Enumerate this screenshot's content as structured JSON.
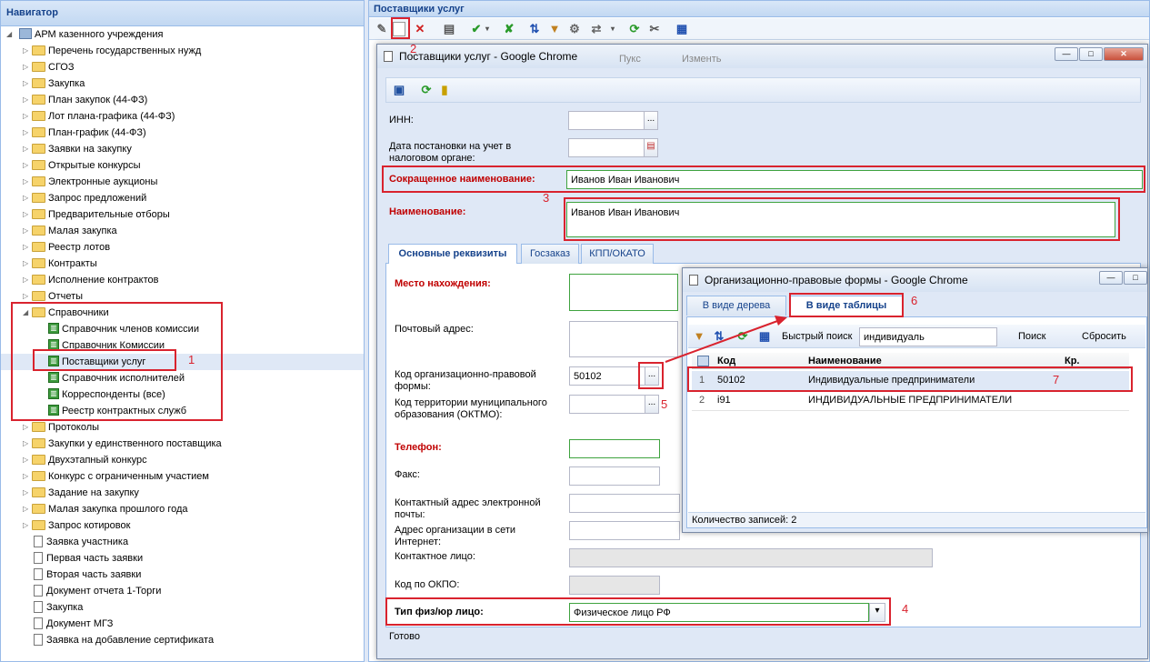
{
  "navigator": {
    "title": "Навигатор",
    "root": "АРМ казенного учреждения",
    "items": [
      "Перечень государственных нужд",
      "СГОЗ",
      "Закупка",
      "План закупок (44-ФЗ)",
      "Лот плана-графика (44-ФЗ)",
      "План-график (44-ФЗ)",
      "Заявки на закупку",
      "Открытые конкурсы",
      "Электронные аукционы",
      "Запрос предложений",
      "Предварительные отборы",
      "Малая закупка",
      "Реестр лотов",
      "Контракты",
      "Исполнение контрактов",
      "Отчеты"
    ],
    "ref_folder": "Справочники",
    "ref_items": [
      "Справочник членов комиссии",
      "Справочник Комиссии",
      "Поставщики услуг",
      "Справочник исполнителей",
      "Корреспонденты (все)",
      "Реестр контрактных служб"
    ],
    "items2": [
      "Протоколы",
      "Закупки у единственного поставщика",
      "Двухэтапный конкурс",
      "Конкурс с ограниченным участием",
      "Задание на закупку",
      "Малая закупка прошлого года",
      "Запрос котировок"
    ],
    "docs": [
      "Заявка участника",
      "Первая часть заявки",
      "Вторая часть заявки",
      "Документ отчета 1-Торги",
      "Закупка",
      "Документ МГЗ",
      "Заявка на добавление сертификата"
    ]
  },
  "main": {
    "title": "Поставщики услуг"
  },
  "editor": {
    "title": "Поставщики услуг - Google Chrome",
    "bg_tabs": [
      "Пукс",
      "Изменть"
    ],
    "fields": {
      "inn_label": "ИНН:",
      "date_label": "Дата постановки на учет в налоговом органе:",
      "short_name_label": "Сокращенное наименование:",
      "short_name_value": "Иванов Иван Иванович",
      "name_label": "Наименование:",
      "name_value": "Иванов Иван Иванович"
    },
    "tabs": [
      "Основные реквизиты",
      "Госзаказ",
      "КПП/ОКАТО"
    ],
    "details": {
      "location_label": "Место нахождения:",
      "postal_label": "Почтовый адрес:",
      "opf_label": "Код организационно-правовой формы:",
      "opf_value": "50102",
      "oktmo_label": "Код территории муниципального образования (ОКТМО):",
      "phone_label": "Телефон:",
      "fax_label": "Факс:",
      "email_label": "Контактный адрес электронной почты:",
      "web_label": "Адрес организации в сети Интернет:",
      "contact_label": "Контактное лицо:",
      "okpo_label": "Код по ОКПО:",
      "type_label": "Тип физ/юр лицо:",
      "type_value": "Физическое лицо РФ"
    },
    "status": "Готово"
  },
  "lookup": {
    "title": "Организационно-правовые формы - Google Chrome",
    "tab_tree": "В виде дерева",
    "tab_table": "В виде таблицы",
    "search_label": "Быстрый поиск",
    "search_value": "индивидуаль",
    "search_button": "Поиск",
    "reset_button": "Сбросить",
    "columns": [
      "Код",
      "Наименование",
      "Кр. наименов"
    ],
    "rows": [
      {
        "n": "1",
        "code": "50102",
        "name": "Индивидуальные предприниматели"
      },
      {
        "n": "2",
        "code": "i91",
        "name": "ИНДИВИДУАЛЬНЫЕ ПРЕДПРИНИМАТЕЛИ"
      }
    ],
    "footer": "Количество записей: 2"
  },
  "annotations": [
    "1",
    "2",
    "3",
    "4",
    "5",
    "6",
    "7"
  ],
  "colors": {
    "accent": "#15428b",
    "annotation": "#d9232e",
    "required": "#c00000"
  }
}
